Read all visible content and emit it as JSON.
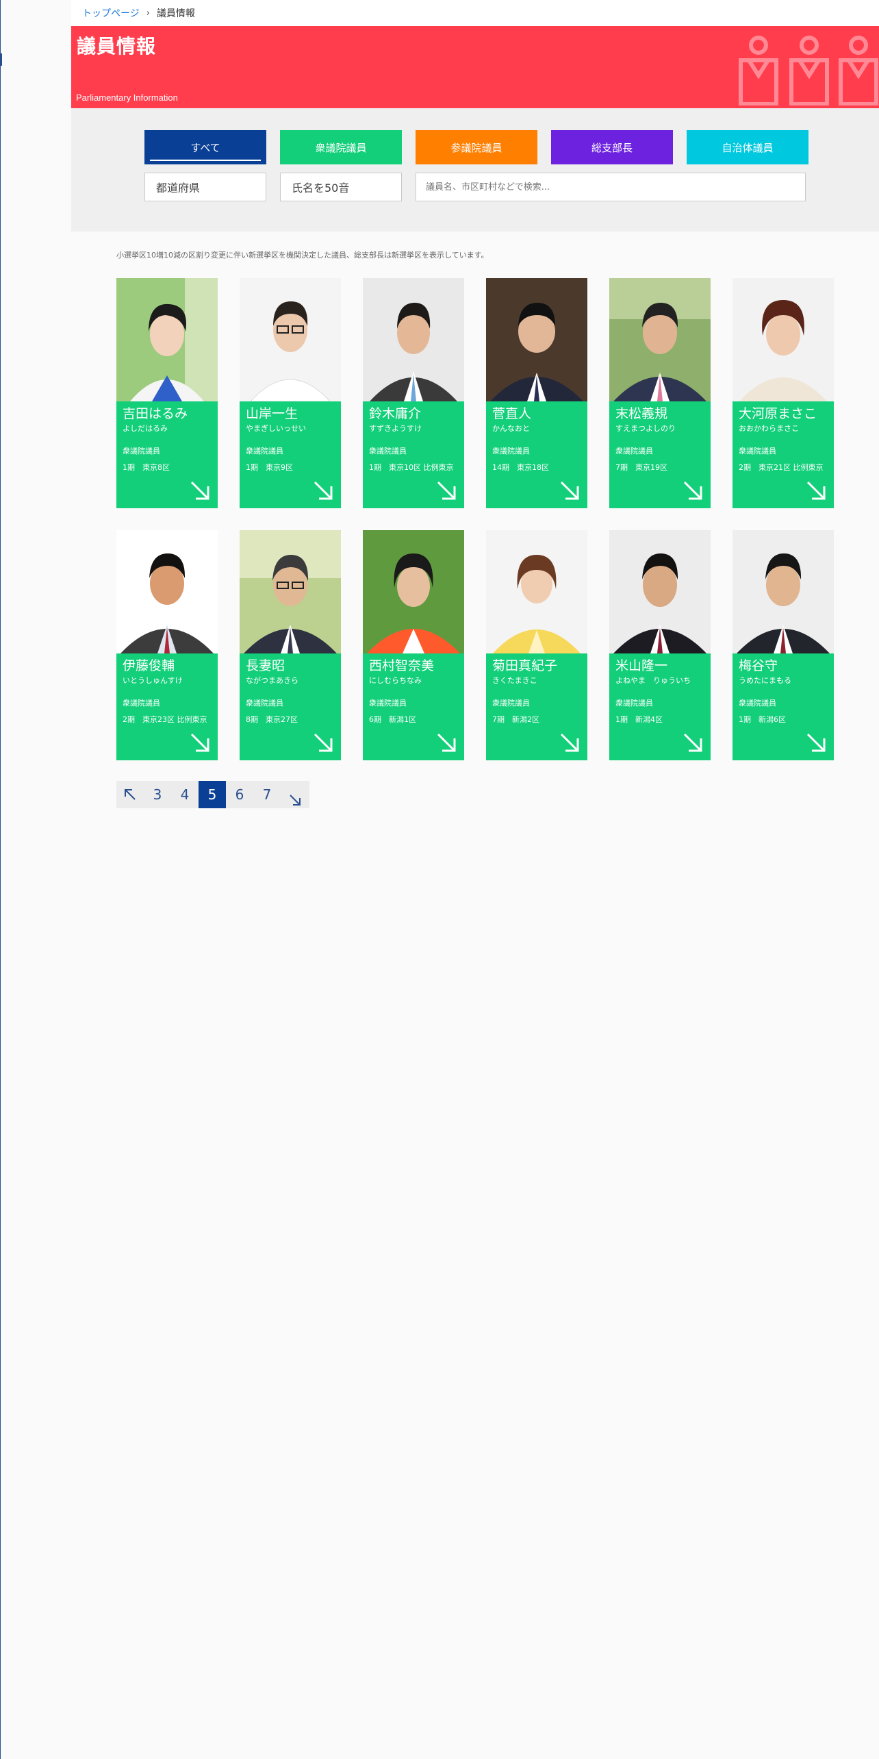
{
  "breadcrumb": {
    "home": "トップページ",
    "current": "議員情報"
  },
  "hero": {
    "title": "議員情報",
    "subtitle": "Parliamentary Information",
    "bg_color": "#ff3d4d"
  },
  "filters": {
    "categories": [
      {
        "label": "すべて",
        "color": "#0a3f96",
        "active": true
      },
      {
        "label": "衆議院議員",
        "color": "#13cf7a"
      },
      {
        "label": "参議院議員",
        "color": "#ff7f00"
      },
      {
        "label": "総支部長",
        "color": "#6d22e0"
      },
      {
        "label": "自治体議員",
        "color": "#00c8de"
      }
    ],
    "prefecture": "都道府県",
    "gojuon": "氏名を50音",
    "search_placeholder": "議員名、市区町村などで検索..."
  },
  "note": "小選挙区10増10減の区割り変更に伴い新選挙区を機関決定した議員、総支部長は新選挙区を表示しています。",
  "members": [
    {
      "name": "吉田はるみ",
      "kana": "よしだはるみ",
      "house": "衆議院議員",
      "term": "1期　東京8区"
    },
    {
      "name": "山岸一生",
      "kana": "やまぎしいっせい",
      "house": "衆議院議員",
      "term": "1期　東京9区"
    },
    {
      "name": "鈴木庸介",
      "kana": "すずきようすけ",
      "house": "衆議院議員",
      "term": "1期　東京10区 比例東京"
    },
    {
      "name": "菅直人",
      "kana": "かんなおと",
      "house": "衆議院議員",
      "term": "14期　東京18区"
    },
    {
      "name": "末松義規",
      "kana": "すえまつよしのり",
      "house": "衆議院議員",
      "term": "7期　東京19区"
    },
    {
      "name": "大河原まさこ",
      "kana": "おおかわらまさこ",
      "house": "衆議院議員",
      "term": "2期　東京21区 比例東京"
    },
    {
      "name": "伊藤俊輔",
      "kana": "いとうしゅんすけ",
      "house": "衆議院議員",
      "term": "2期　東京23区 比例東京"
    },
    {
      "name": "長妻昭",
      "kana": "ながつまあきら",
      "house": "衆議院議員",
      "term": "8期　東京27区"
    },
    {
      "name": "西村智奈美",
      "kana": "にしむらちなみ",
      "house": "衆議院議員",
      "term": "6期　新潟1区"
    },
    {
      "name": "菊田真紀子",
      "kana": "きくたまきこ",
      "house": "衆議院議員",
      "term": "7期　新潟2区"
    },
    {
      "name": "米山隆一",
      "kana": "よねやま　りゅういち",
      "house": "衆議院議員",
      "term": "1期　新潟4区"
    },
    {
      "name": "梅谷守",
      "kana": "うめたにまもる",
      "house": "衆議院議員",
      "term": "1期　新潟6区"
    }
  ],
  "pagination": {
    "pages": [
      "3",
      "4",
      "5",
      "6",
      "7"
    ],
    "current": "5"
  }
}
